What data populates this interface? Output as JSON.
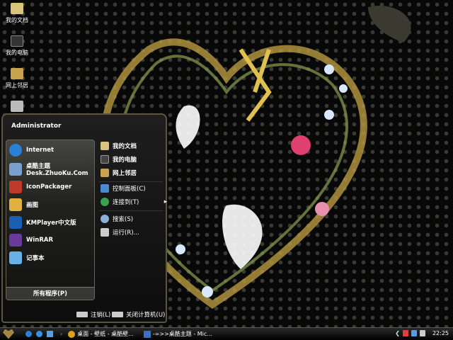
{
  "desktop": {
    "icons": [
      {
        "label": "我的文档",
        "icon": "folder-icon",
        "color": "#d8c47a"
      },
      {
        "label": "我的电脑",
        "icon": "computer-icon",
        "color": "#333"
      },
      {
        "label": "网上邻居",
        "icon": "network-icon",
        "color": "#c9a250"
      },
      {
        "label": "",
        "icon": "recycle-bin-icon",
        "color": "#bbb"
      }
    ]
  },
  "start_menu": {
    "user": "Administrator",
    "pinned": [
      {
        "label": "Internet",
        "icon": "ie-icon",
        "color": "#2a7fd8"
      },
      {
        "label": "桌酷主题",
        "sub": "Desk.ZhuoKu.Com",
        "icon": "zhuoku-icon",
        "color": "#7aa0d0"
      },
      {
        "label": "IconPackager",
        "icon": "iconpackager-icon",
        "color": "#c0392b"
      },
      {
        "label": "画图",
        "icon": "paint-icon",
        "color": "#e0b040"
      },
      {
        "label": "KMPlayer中文版",
        "icon": "kmplayer-icon",
        "color": "#1a5fb0"
      },
      {
        "label": "WinRAR",
        "icon": "winrar-icon",
        "color": "#6a3a9a"
      },
      {
        "label": "记事本",
        "icon": "notepad-icon",
        "color": "#6ab0e8"
      }
    ],
    "all_programs": "所有程序(P)",
    "right": [
      {
        "label": "我的文档",
        "bold": true,
        "icon": "folder-icon",
        "color": "#d8c47a"
      },
      {
        "label": "我的电脑",
        "bold": true,
        "icon": "computer-icon",
        "color": "#444"
      },
      {
        "label": "网上邻居",
        "bold": true,
        "icon": "network-icon",
        "color": "#c9a250"
      },
      {
        "label": "控制面板(C)",
        "icon": "control-panel-icon",
        "color": "#4a8ad0"
      },
      {
        "label": "连接到(T)",
        "icon": "connect-icon",
        "color": "#3aa050",
        "arrow": "▸"
      },
      {
        "label": "搜索(S)",
        "icon": "search-icon",
        "color": "#8ab0d8"
      },
      {
        "label": "运行(R)...",
        "icon": "run-icon",
        "color": "#ccc"
      }
    ],
    "logoff": "注销(L)",
    "shutdown": "关闭计算机(U)"
  },
  "taskbar": {
    "quicklaunch": [
      {
        "icon": "ie-icon",
        "color": "#2a7fd8"
      },
      {
        "icon": "browser-icon",
        "color": "#3a90e0"
      },
      {
        "icon": "show-desktop-icon",
        "color": "#5aa0e0"
      }
    ],
    "tasks": [
      {
        "label": "桌面 - 壁纸 - 桌酷壁...",
        "icon": "chrome-icon",
        "color": "#e0a020"
      },
      {
        "label": "-=>>桌酷主题 - Mic...",
        "icon": "word-icon",
        "color": "#3a70c0"
      }
    ],
    "tray": [
      {
        "icon": "arrow-icon",
        "color": "#ddd"
      },
      {
        "icon": "tray-app-icon",
        "color": "#e04040"
      },
      {
        "icon": "network-tray-icon",
        "color": "#5a9ae0"
      },
      {
        "icon": "volume-icon",
        "color": "#ccc"
      }
    ],
    "clock": "22:25"
  }
}
